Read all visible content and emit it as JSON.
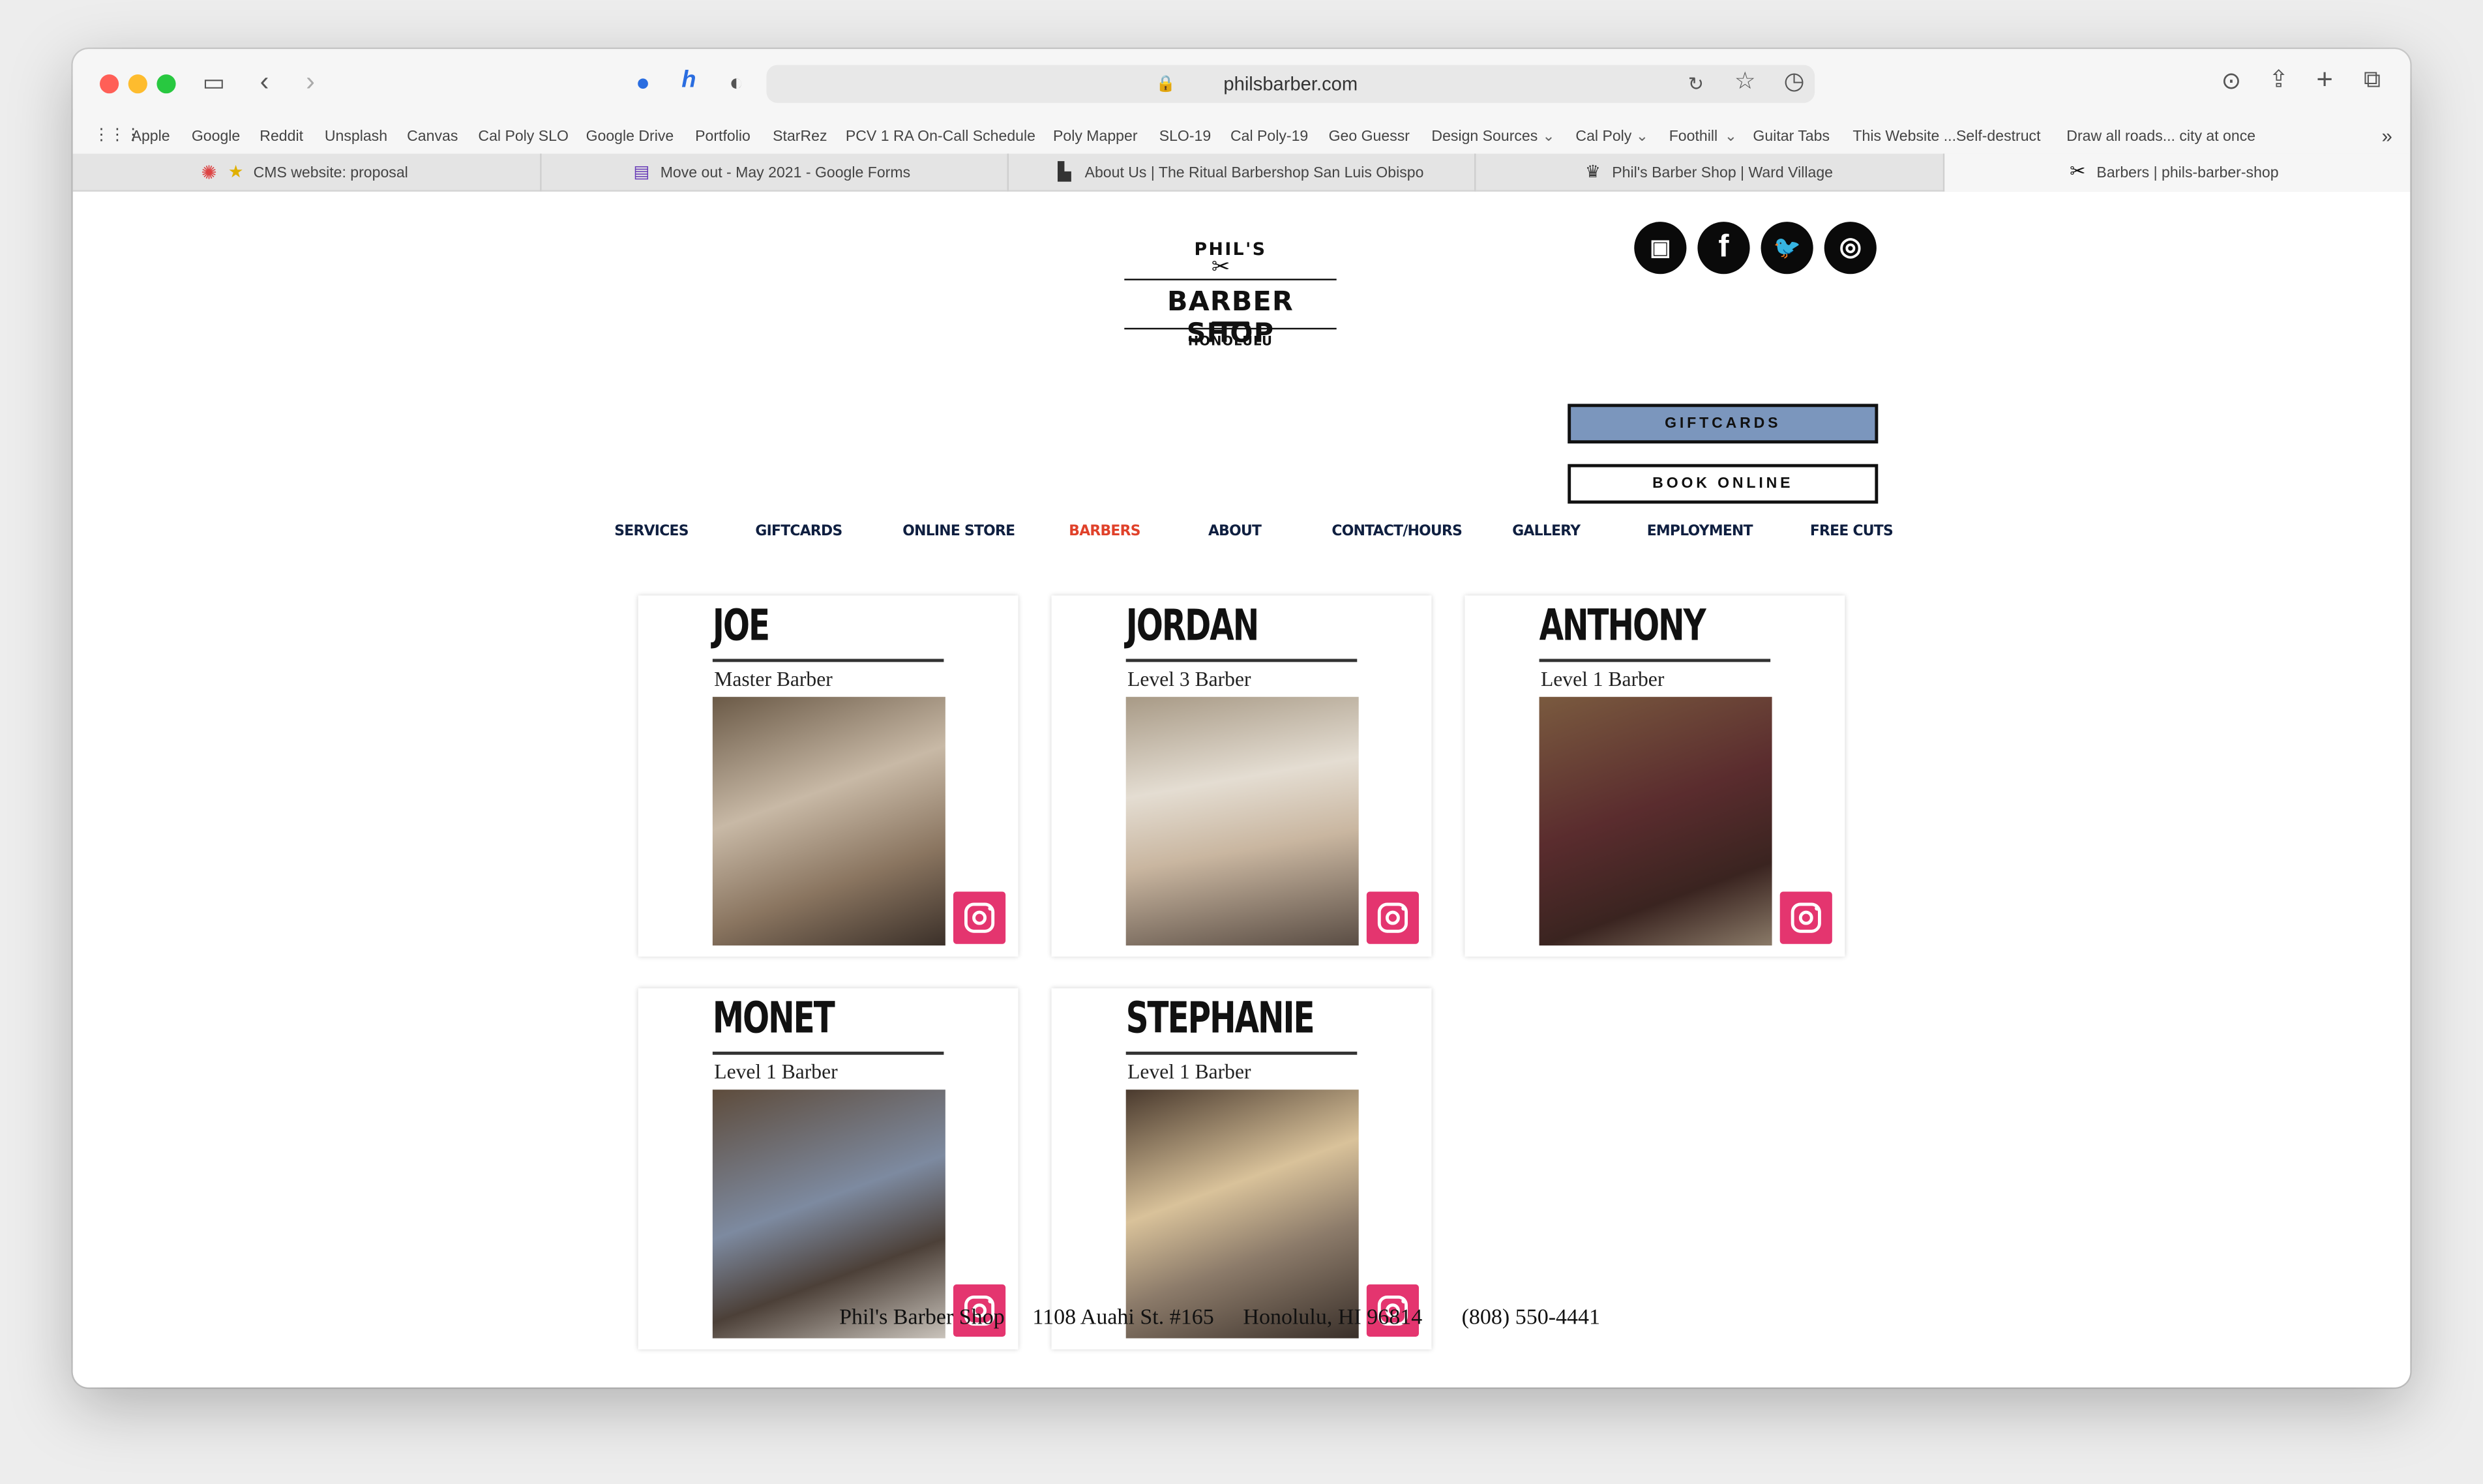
{
  "browser": {
    "url": "philsbarber.com",
    "bookmarks": [
      "Apple",
      "Google",
      "Reddit",
      "Unsplash",
      "Canvas",
      "Cal Poly SLO",
      "Google Drive",
      "Portfolio",
      "StarRez",
      "PCV 1 RA On-Call Schedule",
      "Poly Mapper",
      "SLO-19",
      "Cal Poly-19",
      "Geo Guessr",
      "Design Sources",
      "Cal Poly",
      "Foothill",
      "Guitar Tabs",
      "This Website ...Self-destruct",
      "Draw all roads... city at once"
    ],
    "tabs": [
      {
        "title": "CMS website: proposal"
      },
      {
        "title": "Move out - May 2021 - Google Forms"
      },
      {
        "title": "About Us | The Ritual Barbershop San Luis Obispo"
      },
      {
        "title": "Phil's Barber Shop | Ward Village"
      },
      {
        "title": "Barbers | phils-barber-shop"
      }
    ]
  },
  "logo": {
    "top": "PHIL'S",
    "main": "BARBER SHOP",
    "sub": "HONOLULU"
  },
  "social": [
    {
      "name": "booking-icon",
      "glyph": "▣"
    },
    {
      "name": "facebook-icon",
      "glyph": "f"
    },
    {
      "name": "twitter-icon",
      "glyph": "🐦"
    },
    {
      "name": "instagram-icon",
      "glyph": "◎"
    }
  ],
  "cta": {
    "giftcards": "GIFTCARDS",
    "book_online": "BOOK ONLINE",
    "giftcards_color": "#7b96bd"
  },
  "nav": [
    {
      "label": "SERVICES"
    },
    {
      "label": "GIFTCARDS"
    },
    {
      "label": "ONLINE STORE"
    },
    {
      "label": "BARBERS",
      "active": true
    },
    {
      "label": "ABOUT"
    },
    {
      "label": "CONTACT/HOURS"
    },
    {
      "label": "GALLERY"
    },
    {
      "label": "EMPLOYMENT"
    },
    {
      "label": "FREE CUTS"
    }
  ],
  "colors": {
    "nav_active": "#e0412a",
    "nav": "#0f1f40",
    "instagram": "#e4356f"
  },
  "barbers": [
    {
      "name": "JOE",
      "title": "Master Barber"
    },
    {
      "name": "JORDAN",
      "title": "Level 3 Barber"
    },
    {
      "name": "ANTHONY",
      "title": "Level 1 Barber"
    },
    {
      "name": "MONET",
      "title": "Level 1 Barber"
    },
    {
      "name": "STEPHANIE",
      "title": "Level 1 Barber"
    }
  ],
  "footer": {
    "shop": "Phil's Barber Shop",
    "address": "1108 Auahi St. #165",
    "city": "Honolulu, HI 96814",
    "phone": "(808) 550-4441"
  }
}
